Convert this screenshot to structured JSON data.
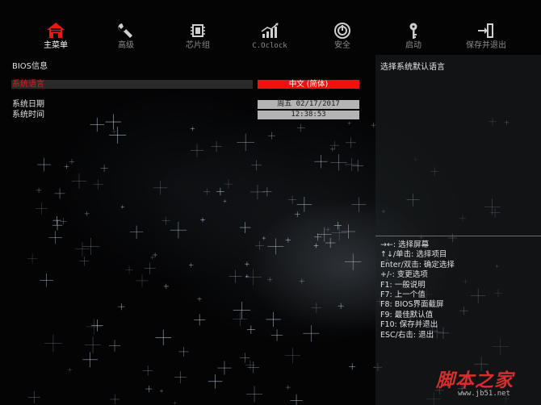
{
  "nav": {
    "items": [
      {
        "label": "主菜单",
        "icon": "home-icon",
        "active": true
      },
      {
        "label": "高级",
        "icon": "wrench-icon",
        "active": false
      },
      {
        "label": "芯片组",
        "icon": "chip-icon",
        "active": false
      },
      {
        "label": "C.Oclock",
        "icon": "performance-chart-icon",
        "active": false
      },
      {
        "label": "安全",
        "icon": "power-shield-icon",
        "active": false
      },
      {
        "label": "启动",
        "icon": "key-icon",
        "active": false
      },
      {
        "label": "保存并退出",
        "icon": "exit-door-icon",
        "active": false
      }
    ]
  },
  "main": {
    "section_title": "BIOS信息",
    "language": {
      "label": "系统语言",
      "value": "中文 (简体)"
    },
    "date": {
      "label": "系统日期",
      "value": "周五 02/17/2017"
    },
    "time": {
      "label": "系统时间",
      "value": "12:38:53"
    }
  },
  "help": {
    "title": "选择系统默认语言",
    "keys": [
      "→←: 选择屏幕",
      "↑↓/单击: 选择项目",
      "Enter/双击: 确定选择",
      "+/-: 变更选项",
      "F1: 一般说明",
      "F7: 上一个值",
      "F8: BIOS界面截屏",
      "F9: 最佳默认值",
      "F10: 保存并退出",
      "ESC/右击: 退出"
    ]
  },
  "watermark": {
    "text": "脚本之家",
    "url": "www.jb51.net"
  },
  "colors": {
    "accent": "#ee1111",
    "active_icon": "#e21a1a",
    "inactive_icon": "#cfcfcf",
    "value_gray": "#b4b4b4"
  }
}
